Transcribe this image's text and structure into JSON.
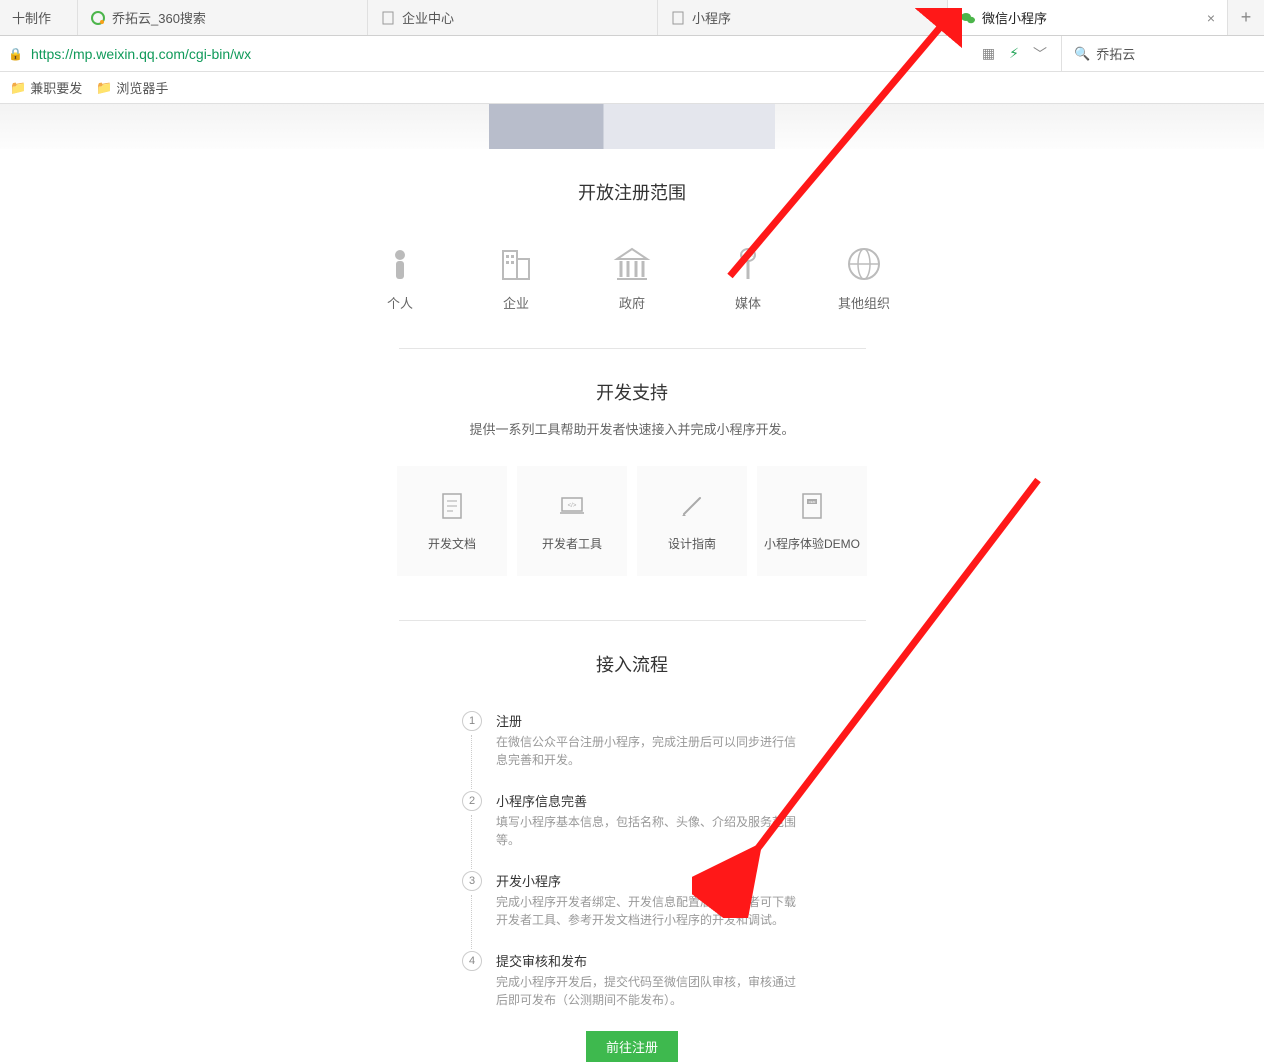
{
  "tabs": {
    "t0": "十制作",
    "t1": "乔拓云_360搜索",
    "t2": "企业中心",
    "t3": "小程序",
    "t4": "微信小程序"
  },
  "url": "https://mp.weixin.qq.com/cgi-bin/wx",
  "search_value": "乔拓云",
  "bookmarks": {
    "b0": "兼职要发",
    "b1": "浏览器手"
  },
  "scope": {
    "title": "开放注册范围",
    "items": {
      "i0": "个人",
      "i1": "企业",
      "i2": "政府",
      "i3": "媒体",
      "i4": "其他组织"
    }
  },
  "support": {
    "title": "开发支持",
    "sub": "提供一系列工具帮助开发者快速接入并完成小程序开发。",
    "cards": {
      "c0": "开发文档",
      "c1": "开发者工具",
      "c2": "设计指南",
      "c3": "小程序体验DEMO"
    }
  },
  "flow": {
    "title": "接入流程",
    "steps": {
      "s1": {
        "num": "1",
        "title": "注册",
        "desc": "在微信公众平台注册小程序，完成注册后可以同步进行信息完善和开发。"
      },
      "s2": {
        "num": "2",
        "title": "小程序信息完善",
        "desc": "填写小程序基本信息，包括名称、头像、介绍及服务范围等。"
      },
      "s3": {
        "num": "3",
        "title": "开发小程序",
        "desc": "完成小程序开发者绑定、开发信息配置后，开发者可下载开发者工具、参考开发文档进行小程序的开发和调试。"
      },
      "s4": {
        "num": "4",
        "title": "提交审核和发布",
        "desc": "完成小程序开发后，提交代码至微信团队审核，审核通过后即可发布（公测期间不能发布）。"
      }
    },
    "cta": "前往注册"
  }
}
